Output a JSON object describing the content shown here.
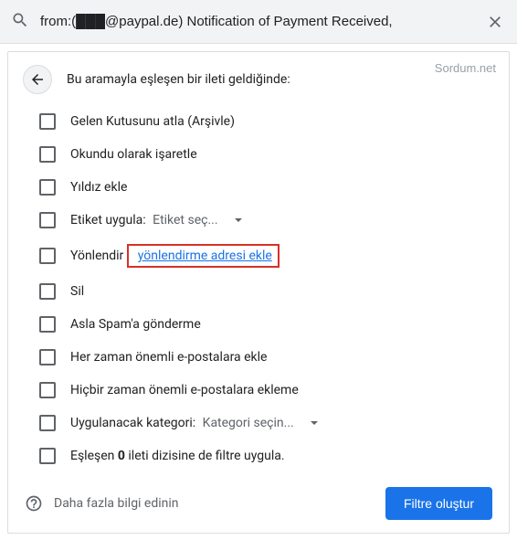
{
  "watermark": "Sordum.net",
  "search": {
    "value": "from:(███@paypal.de) Notification of Payment Received,"
  },
  "header": {
    "title": "Bu aramayla eşleşen bir ileti geldiğinde:"
  },
  "options": {
    "skip_inbox": "Gelen Kutusunu atla (Arşivle)",
    "mark_read": "Okundu olarak işaretle",
    "star": "Yıldız ekle",
    "apply_label_prefix": "Etiket uygula:",
    "apply_label_dropdown": "Etiket seç...",
    "forward_prefix": "Yönlendir",
    "forward_link": "yönlendirme adresi ekle",
    "delete": "Sil",
    "never_spam": "Asla Spam'a gönderme",
    "always_important": "Her zaman önemli e-postalara ekle",
    "never_important": "Hiçbir zaman önemli e-postalara ekleme",
    "category_prefix": "Uygulanacak kategori:",
    "category_dropdown": "Kategori seçin...",
    "also_apply_prefix": "Eşleşen ",
    "also_apply_count": "0",
    "also_apply_suffix": " ileti dizisine de filtre uygula."
  },
  "footer": {
    "learn_more": "Daha fazla bilgi edinin",
    "create_filter": "Filtre oluştur"
  }
}
